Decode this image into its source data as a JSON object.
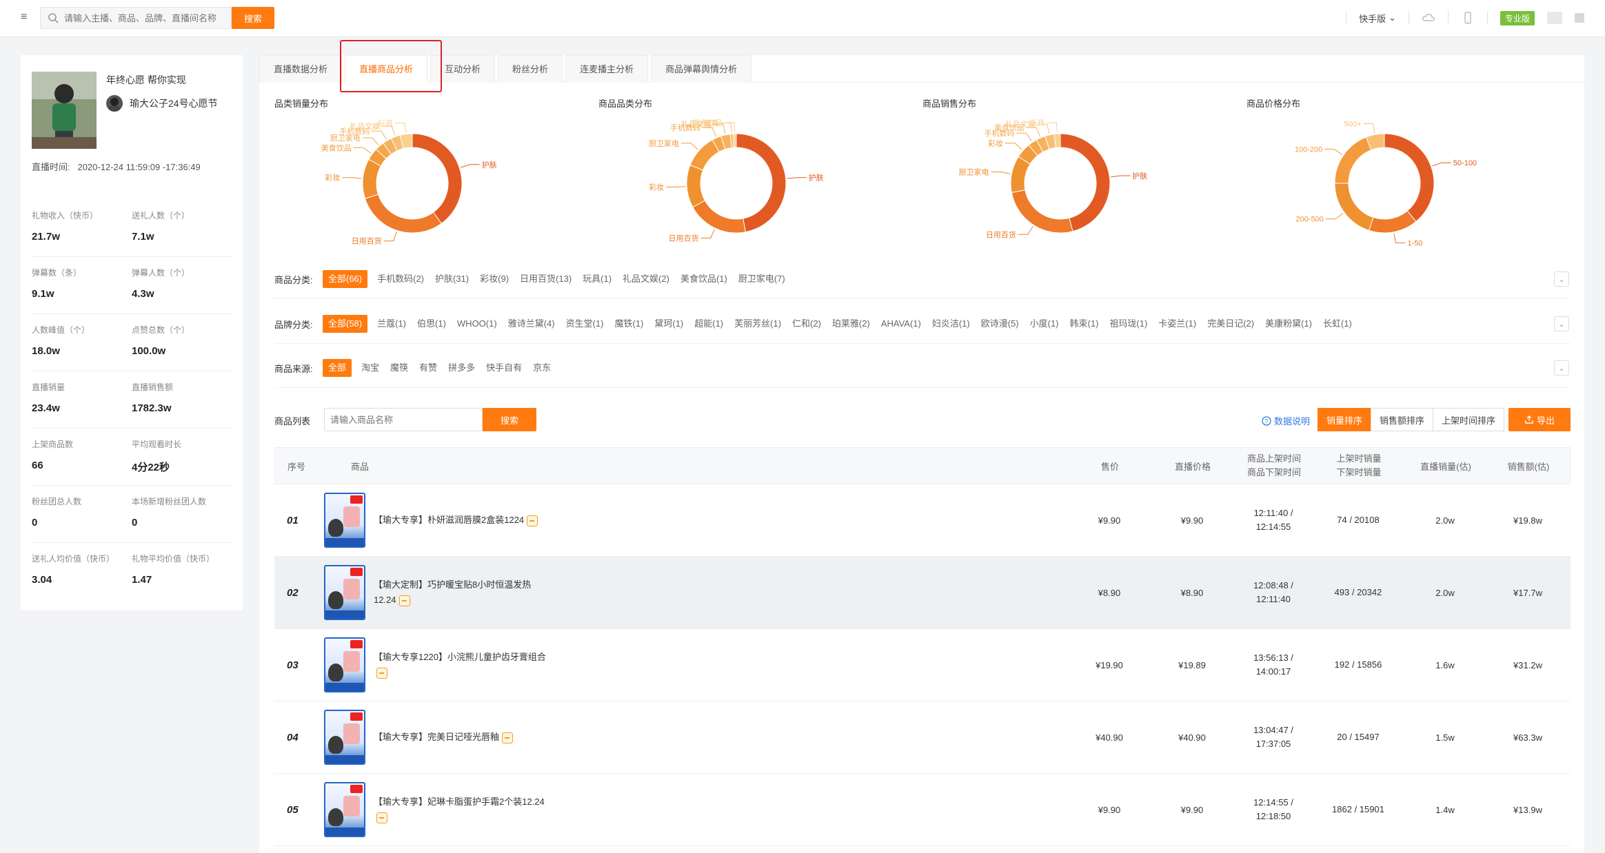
{
  "topbar": {
    "search_placeholder": "请输入主播、商品、品牌、直播间名称",
    "search_label": "搜索",
    "version": "快手版",
    "badge": "专业版"
  },
  "profile": {
    "live_title": "年终心愿 帮你实现",
    "anchor_name": "瑜大公子24号心愿节",
    "live_time_label": "直播时间:",
    "live_time": "2020-12-24 11:59:09 -17:36:49"
  },
  "stats": [
    [
      {
        "label": "礼物收入（快币）",
        "value": "21.7w"
      },
      {
        "label": "送礼人数（个）",
        "value": "7.1w"
      }
    ],
    [
      {
        "label": "弹幕数（条）",
        "value": "9.1w"
      },
      {
        "label": "弹幕人数（个）",
        "value": "4.3w"
      }
    ],
    [
      {
        "label": "人数峰值（个）",
        "value": "18.0w"
      },
      {
        "label": "点赞总数（个）",
        "value": "100.0w"
      }
    ],
    [
      {
        "label": "直播销量",
        "value": "23.4w"
      },
      {
        "label": "直播销售额",
        "value": "1782.3w"
      }
    ],
    [
      {
        "label": "上架商品数",
        "value": "66"
      },
      {
        "label": "平均观看时长",
        "value": "4分22秒"
      }
    ],
    [
      {
        "label": "粉丝团总人数",
        "value": "0"
      },
      {
        "label": "本场新增粉丝团人数",
        "value": "0"
      }
    ],
    [
      {
        "label": "送礼人均价值（快币）",
        "value": "3.04"
      },
      {
        "label": "礼物平均价值（快币）",
        "value": "1.47"
      }
    ]
  ],
  "tabs": [
    "直播数据分析",
    "直播商品分析",
    "互动分析",
    "粉丝分析",
    "连麦播主分析",
    "商品弹幕舆情分析"
  ],
  "active_tab": 1,
  "colors": {
    "accent": "#ff7a0f",
    "highlight": "#e02020",
    "link": "#2f7ae5"
  },
  "chart_data": [
    {
      "type": "pie",
      "title": "品类销量分布",
      "slices": [
        {
          "label": "护肤",
          "value": 40,
          "color": "#e25a23"
        },
        {
          "label": "日用百货",
          "value": 30,
          "color": "#ee7a2a"
        },
        {
          "label": "彩妆",
          "value": 13,
          "color": "#f0912f"
        },
        {
          "label": "美食饮品",
          "value": 4,
          "color": "#f39b3d"
        },
        {
          "label": "厨卫家电",
          "value": 3,
          "color": "#f5a74d"
        },
        {
          "label": "手机数码",
          "value": 3,
          "color": "#f6b25f"
        },
        {
          "label": "礼品文娱",
          "value": 3,
          "color": "#f8bf74"
        },
        {
          "label": "玩具",
          "value": 4,
          "color": "#fad18d"
        }
      ]
    },
    {
      "type": "pie",
      "title": "商品品类分布",
      "slices": [
        {
          "label": "护肤",
          "value": 47,
          "color": "#e25a23"
        },
        {
          "label": "日用百货",
          "value": 20,
          "color": "#ee7a2a"
        },
        {
          "label": "彩妆",
          "value": 14,
          "color": "#f0912f"
        },
        {
          "label": "厨卫家电",
          "value": 11,
          "color": "#f39b3d"
        },
        {
          "label": "手机数码",
          "value": 3,
          "color": "#f5a74d"
        },
        {
          "label": "礼品文娱",
          "value": 3,
          "color": "#f6b25f"
        },
        {
          "label": "玩具",
          "value": 1,
          "color": "#f8bf74"
        },
        {
          "label": "美食饮品",
          "value": 1,
          "color": "#fad18d"
        }
      ]
    },
    {
      "type": "pie",
      "title": "商品销售分布",
      "slices": [
        {
          "label": "护肤",
          "value": 46,
          "color": "#e25a23"
        },
        {
          "label": "日用百货",
          "value": 26,
          "color": "#ee7a2a"
        },
        {
          "label": "厨卫家电",
          "value": 12,
          "color": "#f0912f"
        },
        {
          "label": "彩妆",
          "value": 5,
          "color": "#f39b3d"
        },
        {
          "label": "手机数码",
          "value": 3,
          "color": "#f5a74d"
        },
        {
          "label": "美食饮品",
          "value": 3,
          "color": "#f6b25f"
        },
        {
          "label": "礼品文娱",
          "value": 3,
          "color": "#f8bf74"
        },
        {
          "label": "玩具",
          "value": 2,
          "color": "#fad18d"
        }
      ]
    },
    {
      "type": "pie",
      "title": "商品价格分布",
      "slices": [
        {
          "label": "50-100",
          "value": 39,
          "color": "#e25a23"
        },
        {
          "label": "1-50",
          "value": 16,
          "color": "#ee7a2a"
        },
        {
          "label": "200-500",
          "value": 20,
          "color": "#f0912f"
        },
        {
          "label": "100-200",
          "value": 19,
          "color": "#f39b3d"
        },
        {
          "label": "500+",
          "value": 6,
          "color": "#f8bf74"
        }
      ]
    }
  ],
  "filters": [
    {
      "label": "商品分类:",
      "options": [
        "全部(66)",
        "手机数码(2)",
        "护肤(31)",
        "彩妆(9)",
        "日用百货(13)",
        "玩具(1)",
        "礼品文娱(2)",
        "美食饮品(1)",
        "厨卫家电(7)"
      ]
    },
    {
      "label": "品牌分类:",
      "options": [
        "全部(58)",
        "兰蔻(1)",
        "伯思(1)",
        "WHOO(1)",
        "雅诗兰黛(4)",
        "资生堂(1)",
        "魔铁(1)",
        "黛珂(1)",
        "超能(1)",
        "芙丽芳丝(1)",
        "仁和(2)",
        "珀莱雅(2)",
        "AHAVA(1)",
        "妇炎洁(1)",
        "欧诗漫(5)",
        "小度(1)",
        "韩束(1)",
        "祖玛珑(1)",
        "卡姿兰(1)",
        "完美日记(2)",
        "美康粉黛(1)",
        "长虹(1)"
      ]
    },
    {
      "label": "商品来源:",
      "options": [
        "全部",
        "淘宝",
        "魔筷",
        "有赞",
        "拼多多",
        "快手自有",
        "京东"
      ]
    }
  ],
  "list": {
    "label": "商品列表",
    "placeholder": "请输入商品名称",
    "search_label": "搜索",
    "data_note": "数据说明",
    "sorts": [
      "销量排序",
      "销售额排序",
      "上架时间排序"
    ],
    "export": "导出"
  },
  "table": {
    "headers": {
      "idx": "序号",
      "product": "商品",
      "price": "售价",
      "live_price": "直播价格",
      "time_1": "商品上架时间",
      "time_2": "商品下架时间",
      "shelf_1": "上架时销量",
      "shelf_2": "下架时销量",
      "volume": "直播销量(估)",
      "amount": "销售额(估)"
    },
    "rows": [
      {
        "idx": "01",
        "name": "【瑜大专享】朴妍滋润唇膜2盒装1224",
        "price": "¥9.90",
        "live_price": "¥9.90",
        "on": "12:11:40 /",
        "off": "12:14:55",
        "shelf": "74 / 20108",
        "volume": "2.0w",
        "amount": "¥19.8w"
      },
      {
        "idx": "02",
        "name": "【瑜大定制】巧护暖宝贴8小时恒温发热12.24",
        "price": "¥8.90",
        "live_price": "¥8.90",
        "on": "12:08:48 /",
        "off": "12:11:40",
        "shelf": "493 / 20342",
        "volume": "2.0w",
        "amount": "¥17.7w"
      },
      {
        "idx": "03",
        "name": "【瑜大专享1220】小浣熊儿童护齿牙膏组合",
        "price": "¥19.90",
        "live_price": "¥19.89",
        "on": "13:56:13 /",
        "off": "14:00:17",
        "shelf": "192 / 15856",
        "volume": "1.6w",
        "amount": "¥31.2w"
      },
      {
        "idx": "04",
        "name": "【瑜大专享】完美日记哑光唇釉",
        "price": "¥40.90",
        "live_price": "¥40.90",
        "on": "13:04:47 /",
        "off": "17:37:05",
        "shelf": "20 / 15497",
        "volume": "1.5w",
        "amount": "¥63.3w"
      },
      {
        "idx": "05",
        "name": "【瑜大专享】妃琳卡脂蛋护手霜2个装12.24",
        "price": "¥9.90",
        "live_price": "¥9.90",
        "on": "12:14:55 /",
        "off": "12:18:50",
        "shelf": "1862 / 15901",
        "volume": "1.4w",
        "amount": "¥13.9w"
      }
    ]
  }
}
